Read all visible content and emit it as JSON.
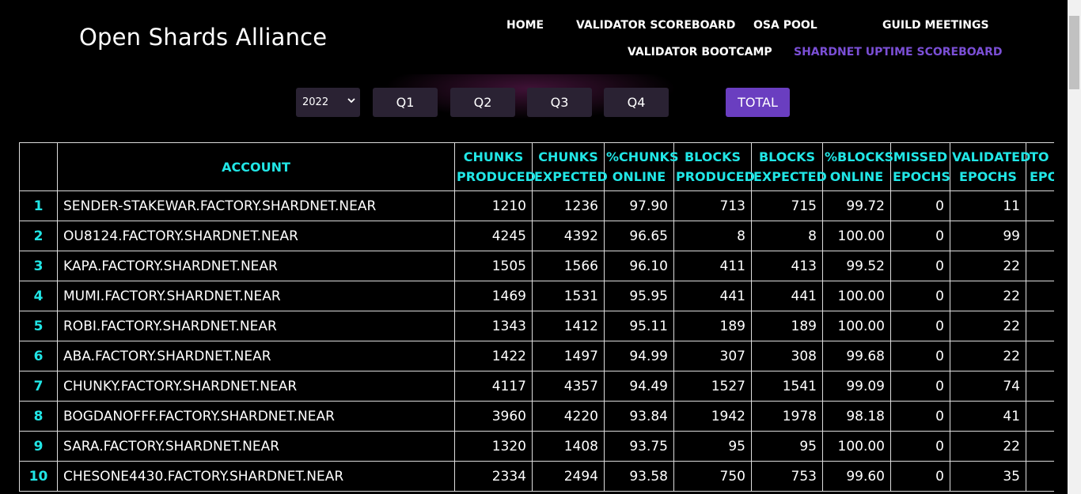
{
  "brand": "Open Shards Alliance",
  "nav": {
    "home": "HOME",
    "validator_scoreboard": "VALIDATOR SCOREBOARD",
    "osa_pool": "OSA POOL",
    "guild_meetings": "GUILD MEETINGS",
    "validator_bootcamp": "VALIDATOR BOOTCAMP",
    "shardnet_uptime": "SHARDNET UPTIME SCOREBOARD"
  },
  "filters": {
    "year": "2022",
    "q1": "Q1",
    "q2": "Q2",
    "q3": "Q3",
    "q4": "Q4",
    "total": "TOTAL"
  },
  "table": {
    "headers": {
      "account": "ACCOUNT",
      "chunks_produced": [
        "CHUNKS",
        "PRODUCED"
      ],
      "chunks_expected": [
        "CHUNKS",
        "EXPECTED"
      ],
      "chunks_online": [
        "%CHUNKS",
        "ONLINE"
      ],
      "blocks_produced": [
        "BLOCKS",
        "PRODUCED"
      ],
      "blocks_expected": [
        "BLOCKS",
        "EXPECTED"
      ],
      "blocks_online": [
        "%BLOCKS",
        "ONLINE"
      ],
      "missed_epochs": [
        "MISSED",
        "EPOCHS"
      ],
      "validated_epochs": [
        "VALIDATED",
        "EPOCHS"
      ],
      "total_epochs": [
        "TO",
        "EPO"
      ]
    },
    "rows": [
      {
        "idx": "1",
        "account": "SENDER-STAKEWAR.FACTORY.SHARDNET.NEAR",
        "cp": "1210",
        "ce": "1236",
        "co": "97.90",
        "bp": "713",
        "be": "715",
        "bo": "99.72",
        "me": "0",
        "ve": "11"
      },
      {
        "idx": "2",
        "account": "OU8124.FACTORY.SHARDNET.NEAR",
        "cp": "4245",
        "ce": "4392",
        "co": "96.65",
        "bp": "8",
        "be": "8",
        "bo": "100.00",
        "me": "0",
        "ve": "99"
      },
      {
        "idx": "3",
        "account": "KAPA.FACTORY.SHARDNET.NEAR",
        "cp": "1505",
        "ce": "1566",
        "co": "96.10",
        "bp": "411",
        "be": "413",
        "bo": "99.52",
        "me": "0",
        "ve": "22"
      },
      {
        "idx": "4",
        "account": "MUMI.FACTORY.SHARDNET.NEAR",
        "cp": "1469",
        "ce": "1531",
        "co": "95.95",
        "bp": "441",
        "be": "441",
        "bo": "100.00",
        "me": "0",
        "ve": "22"
      },
      {
        "idx": "5",
        "account": "ROBI.FACTORY.SHARDNET.NEAR",
        "cp": "1343",
        "ce": "1412",
        "co": "95.11",
        "bp": "189",
        "be": "189",
        "bo": "100.00",
        "me": "0",
        "ve": "22"
      },
      {
        "idx": "6",
        "account": "ABA.FACTORY.SHARDNET.NEAR",
        "cp": "1422",
        "ce": "1497",
        "co": "94.99",
        "bp": "307",
        "be": "308",
        "bo": "99.68",
        "me": "0",
        "ve": "22"
      },
      {
        "idx": "7",
        "account": "CHUNKY.FACTORY.SHARDNET.NEAR",
        "cp": "4117",
        "ce": "4357",
        "co": "94.49",
        "bp": "1527",
        "be": "1541",
        "bo": "99.09",
        "me": "0",
        "ve": "74"
      },
      {
        "idx": "8",
        "account": "BOGDANOFFF.FACTORY.SHARDNET.NEAR",
        "cp": "3960",
        "ce": "4220",
        "co": "93.84",
        "bp": "1942",
        "be": "1978",
        "bo": "98.18",
        "me": "0",
        "ve": "41"
      },
      {
        "idx": "9",
        "account": "SARA.FACTORY.SHARDNET.NEAR",
        "cp": "1320",
        "ce": "1408",
        "co": "93.75",
        "bp": "95",
        "be": "95",
        "bo": "100.00",
        "me": "0",
        "ve": "22"
      },
      {
        "idx": "10",
        "account": "CHESONE4430.FACTORY.SHARDNET.NEAR",
        "cp": "2334",
        "ce": "2494",
        "co": "93.58",
        "bp": "750",
        "be": "753",
        "bo": "99.60",
        "me": "0",
        "ve": "35"
      }
    ]
  },
  "colors": {
    "background": "#000000",
    "header_cyan": "#21e6e6",
    "active_nav": "#7b4fd6",
    "total_button": "#6a3ec0",
    "filter_button": "#2a2233"
  }
}
